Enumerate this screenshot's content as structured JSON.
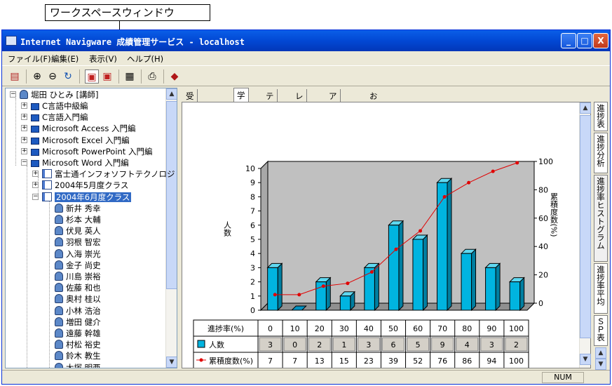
{
  "annotation": {
    "label": "ワークスペースウィンドウ"
  },
  "window": {
    "title": "Internet Navigware 成績管理サービス - localhost"
  },
  "title_buttons": {
    "minimize": "_",
    "maximize": "□",
    "close": "X"
  },
  "menu": [
    "ファイル(F)",
    "編集(E)",
    "表示(V)",
    "ヘルプ(H)"
  ],
  "tree": {
    "root": "堀田 ひとみ [講師]",
    "courses": [
      "C言語中級編",
      "C言語入門編",
      "Microsoft Access 入門編",
      "Microsoft Excel 入門編",
      "Microsoft PowerPoint 入門編",
      "Microsoft Word 入門編"
    ],
    "classes": [
      "富士通インフォソフトテクノロジ",
      "2004年5月度クラス",
      "2004年6月度クラス"
    ],
    "students": [
      "新井 秀幸",
      "杉本 大輔",
      "伏見 英人",
      "羽根 智宏",
      "入海 崇光",
      "金子 尚史",
      "川島 崇裕",
      "佐藤 和也",
      "奥村 桂以",
      "小林 浩治",
      "増田 健介",
      "遠藤 幹雄",
      "村松 裕史",
      "鈴木 教生",
      "大塚 明亜"
    ]
  },
  "tabs": [
    "受講者情報",
    "学習",
    "テスト",
    "レポート",
    "アンケート",
    "お知らせ"
  ],
  "side_tabs": [
    "進捗表",
    "進捗分析",
    "進捗率ヒストグラム",
    "進捗率平均",
    "ＳＰ表"
  ],
  "status": {
    "num": "NUM"
  },
  "chart_data": {
    "type": "bar",
    "categories": [
      "0",
      "10",
      "20",
      "30",
      "40",
      "50",
      "60",
      "70",
      "80",
      "90",
      "100"
    ],
    "series": [
      {
        "name": "人数",
        "type": "bar",
        "values": [
          3,
          0,
          2,
          1,
          3,
          6,
          5,
          9,
          4,
          3,
          2
        ],
        "color": "#00b4e0",
        "axis": "left"
      },
      {
        "name": "累積度数(%)",
        "type": "line",
        "values": [
          7,
          7,
          13,
          15,
          23,
          39,
          52,
          76,
          86,
          94,
          100
        ],
        "color": "#e00000",
        "axis": "right"
      }
    ],
    "ylabel_left": "人数",
    "ylabel_right": "累積度数(%)",
    "ylim_left": [
      0,
      10
    ],
    "ylim_right": [
      0,
      100
    ],
    "yticks_left": [
      "0",
      "1",
      "2",
      "3",
      "4",
      "5",
      "6",
      "7",
      "8",
      "9",
      "10"
    ],
    "yticks_right": [
      "0",
      "20",
      "40",
      "60",
      "80",
      "100"
    ],
    "table_header": "進捗率(%)"
  }
}
